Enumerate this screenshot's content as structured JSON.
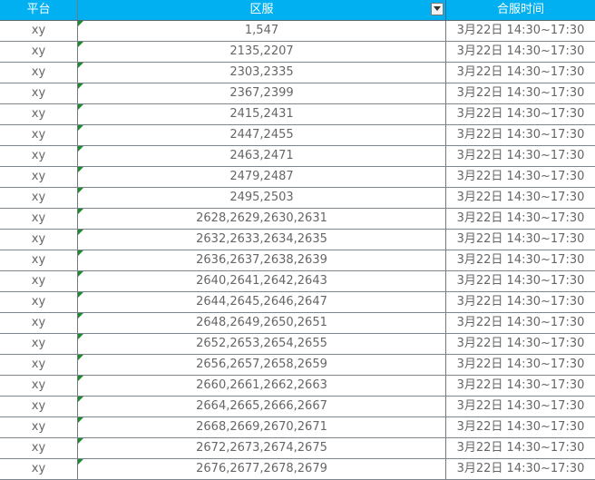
{
  "header": {
    "platform": "平台",
    "server": "区服",
    "merge_time": "合服时间"
  },
  "rows": [
    {
      "platform": "xy",
      "servers": "1,547",
      "time": "3月22日 14:30~17:30"
    },
    {
      "platform": "xy",
      "servers": "2135,2207",
      "time": "3月22日 14:30~17:30"
    },
    {
      "platform": "xy",
      "servers": "2303,2335",
      "time": "3月22日 14:30~17:30"
    },
    {
      "platform": "xy",
      "servers": "2367,2399",
      "time": "3月22日 14:30~17:30"
    },
    {
      "platform": "xy",
      "servers": "2415,2431",
      "time": "3月22日 14:30~17:30"
    },
    {
      "platform": "xy",
      "servers": "2447,2455",
      "time": "3月22日 14:30~17:30"
    },
    {
      "platform": "xy",
      "servers": "2463,2471",
      "time": "3月22日 14:30~17:30"
    },
    {
      "platform": "xy",
      "servers": "2479,2487",
      "time": "3月22日 14:30~17:30"
    },
    {
      "platform": "xy",
      "servers": "2495,2503",
      "time": "3月22日 14:30~17:30"
    },
    {
      "platform": "xy",
      "servers": "2628,2629,2630,2631",
      "time": "3月22日 14:30~17:30"
    },
    {
      "platform": "xy",
      "servers": "2632,2633,2634,2635",
      "time": "3月22日 14:30~17:30"
    },
    {
      "platform": "xy",
      "servers": "2636,2637,2638,2639",
      "time": "3月22日 14:30~17:30"
    },
    {
      "platform": "xy",
      "servers": "2640,2641,2642,2643",
      "time": "3月22日 14:30~17:30"
    },
    {
      "platform": "xy",
      "servers": "2644,2645,2646,2647",
      "time": "3月22日 14:30~17:30"
    },
    {
      "platform": "xy",
      "servers": "2648,2649,2650,2651",
      "time": "3月22日 14:30~17:30"
    },
    {
      "platform": "xy",
      "servers": "2652,2653,2654,2655",
      "time": "3月22日 14:30~17:30"
    },
    {
      "platform": "xy",
      "servers": "2656,2657,2658,2659",
      "time": "3月22日 14:30~17:30"
    },
    {
      "platform": "xy",
      "servers": "2660,2661,2662,2663",
      "time": "3月22日 14:30~17:30"
    },
    {
      "platform": "xy",
      "servers": "2664,2665,2666,2667",
      "time": "3月22日 14:30~17:30"
    },
    {
      "platform": "xy",
      "servers": "2668,2669,2670,2671",
      "time": "3月22日 14:30~17:30"
    },
    {
      "platform": "xy",
      "servers": "2672,2673,2674,2675",
      "time": "3月22日 14:30~17:30"
    },
    {
      "platform": "xy",
      "servers": "2676,2677,2678,2679",
      "time": "3月22日 14:30~17:30"
    }
  ],
  "colors": {
    "header_bg": "#00B0F0",
    "header_text": "#FFFFFF",
    "cell_text": "#666666",
    "error_indicator": "#1E8A2E"
  },
  "icons": {
    "filter": "filter-dropdown-icon",
    "cell_marker": "error-indicator-icon"
  }
}
